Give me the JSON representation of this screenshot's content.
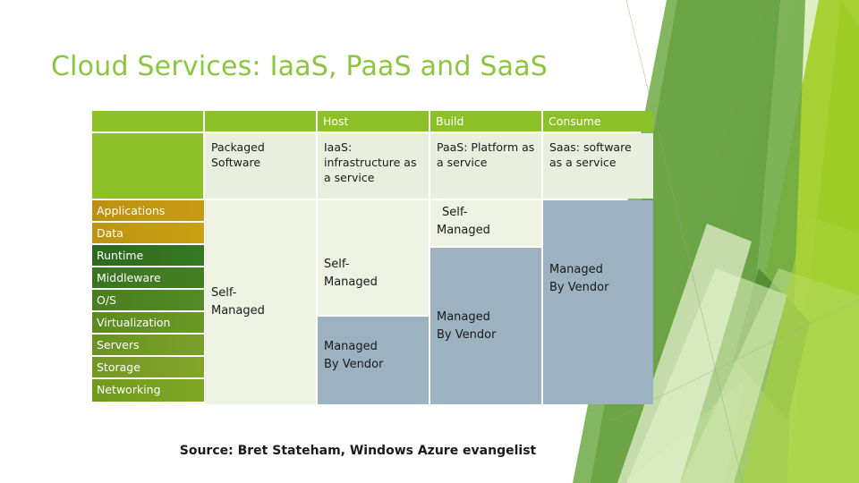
{
  "slide": {
    "title": "Cloud Services: IaaS, PaaS and SaaS",
    "source_caption": "Source: Bret Stateham, Windows Azure evangelist",
    "title_color": "#8CC63E",
    "header_green": "#8CC227",
    "cell_green": "#EDF2E2",
    "cell_blue": "#9DB2C0"
  },
  "table": {
    "header_row": [
      {
        "label": ""
      },
      {
        "label": ""
      },
      {
        "label": "Host"
      },
      {
        "label": "Build"
      },
      {
        "label": "Consume"
      }
    ],
    "description_row": [
      {
        "label": ""
      },
      {
        "label": "Packaged Software"
      },
      {
        "label": "IaaS: infrastructure as a service"
      },
      {
        "label": "PaaS: Platform as a service"
      },
      {
        "label": "Saas: software as a service"
      }
    ],
    "stack_labels": [
      {
        "label": "Applications",
        "color": "#BC9012"
      },
      {
        "label": "Data",
        "color": "#BD9411"
      },
      {
        "label": "Runtime",
        "color": "#2F6B20"
      },
      {
        "label": "Middleware",
        "color": "#3C7420"
      },
      {
        "label": "O/S",
        "color": "#4A7D20"
      },
      {
        "label": "Virtualization",
        "color": "#5C8A22"
      },
      {
        "label": "Servers",
        "color": "#6A9223"
      },
      {
        "label": "Storage",
        "color": "#789B24"
      },
      {
        "label": "Networking",
        "color": "#6F9A1E"
      }
    ],
    "packaged_column": {
      "managed": "Self-\nManaged",
      "managed_line1": "Self-",
      "managed_line2": "Managed"
    },
    "host_column": {
      "self_managed_line1": "Self-",
      "self_managed_line2": "Managed",
      "vendor_line1": "Managed",
      "vendor_line2": "By Vendor"
    },
    "build_column": {
      "self_managed_line1": "Self-",
      "self_managed_line2": "Managed",
      "vendor_line1": "Managed",
      "vendor_line2": "By Vendor"
    },
    "consume_column": {
      "vendor_line1": "Managed",
      "vendor_line2": "By Vendor"
    }
  }
}
